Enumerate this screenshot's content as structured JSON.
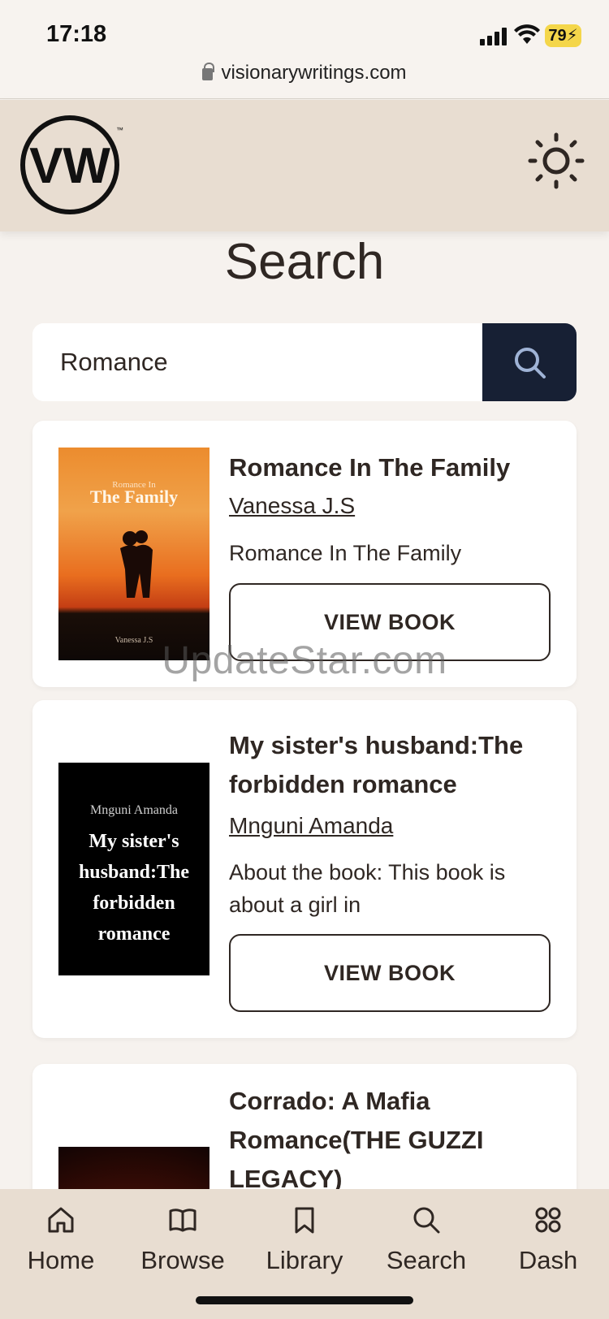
{
  "status_bar": {
    "time": "17:18",
    "battery": "79",
    "url": "visionarywritings.com"
  },
  "header": {
    "logo_text": "VW",
    "theme_icon": "sun-icon"
  },
  "page": {
    "title": "Search"
  },
  "search": {
    "value": "Romance",
    "icon": "search-icon"
  },
  "results": [
    {
      "title": "Romance In The Family",
      "author": "Vanessa J.S",
      "description": "Romance In The Family",
      "button": "VIEW BOOK",
      "cover": {
        "small_text": "Romance In",
        "big_text": "The Family",
        "author": "Vanessa J.S"
      }
    },
    {
      "title": "My sister's husband:The forbidden romance",
      "author": "Mnguni Amanda",
      "description": "About the book: This book is about a girl in",
      "button": "VIEW BOOK",
      "cover": {
        "author": "Mnguni Amanda",
        "title": "My sister's husband:The forbidden romance"
      }
    },
    {
      "title": "Corrado: A Mafia Romance(THE GUZZI LEGACY)"
    }
  ],
  "watermark": "UpdateStar.com",
  "bottom_nav": [
    {
      "label": "Home",
      "icon": "home-icon"
    },
    {
      "label": "Browse",
      "icon": "book-open-icon"
    },
    {
      "label": "Library",
      "icon": "bookmark-icon"
    },
    {
      "label": "Search",
      "icon": "search-icon"
    },
    {
      "label": "Dash",
      "icon": "grid-icon"
    }
  ]
}
